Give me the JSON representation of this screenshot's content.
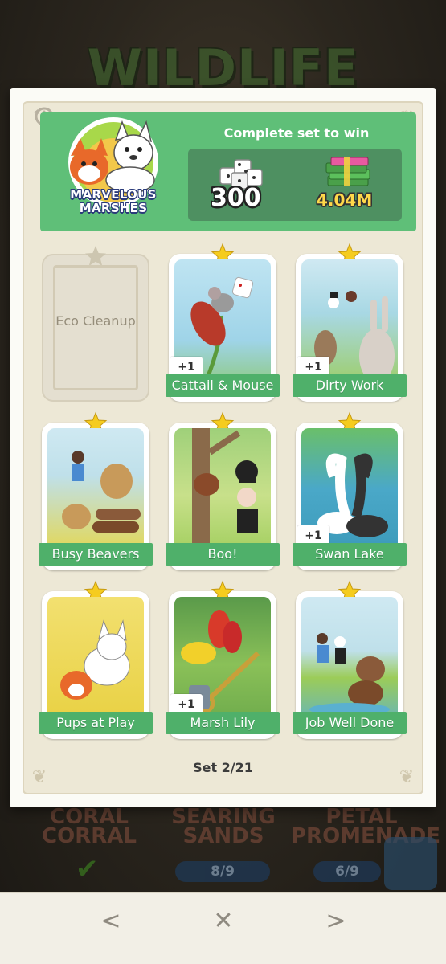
{
  "background": {
    "title": "WILDLIFE",
    "sets": [
      {
        "name": "CORAL CORRAL"
      },
      {
        "name": "SEARING SANDS",
        "progress": "8/9"
      },
      {
        "name": "PETAL PROMENADE",
        "progress": "6/9"
      }
    ]
  },
  "album": {
    "set_name": "MARVELOUS MARSHES",
    "reward_title": "Complete set to win",
    "reward_dice": "300",
    "reward_cash": "4.04M",
    "set_count": "Set 2/21"
  },
  "stickers": [
    {
      "name": "Eco Cleanup",
      "collected": false
    },
    {
      "name": "Cattail & Mouse",
      "collected": true,
      "extra": "+1"
    },
    {
      "name": "Dirty Work",
      "collected": true,
      "extra": "+1"
    },
    {
      "name": "Busy Beavers",
      "collected": true
    },
    {
      "name": "Boo!",
      "collected": true
    },
    {
      "name": "Swan Lake",
      "collected": true,
      "extra": "+1"
    },
    {
      "name": "Pups at Play",
      "collected": true
    },
    {
      "name": "Marsh Lily",
      "collected": true,
      "extra": "+1"
    },
    {
      "name": "Job Well Done",
      "collected": true
    }
  ],
  "nav": {
    "prev": "<",
    "close": "✕",
    "next": ">"
  },
  "colors": {
    "banner": "#5fbf78",
    "label": "#4fb06a",
    "star": "#f5cc1f"
  },
  "icons": [
    "history-icon",
    "dice-icon",
    "cash-stack-icon",
    "star-icon"
  ]
}
